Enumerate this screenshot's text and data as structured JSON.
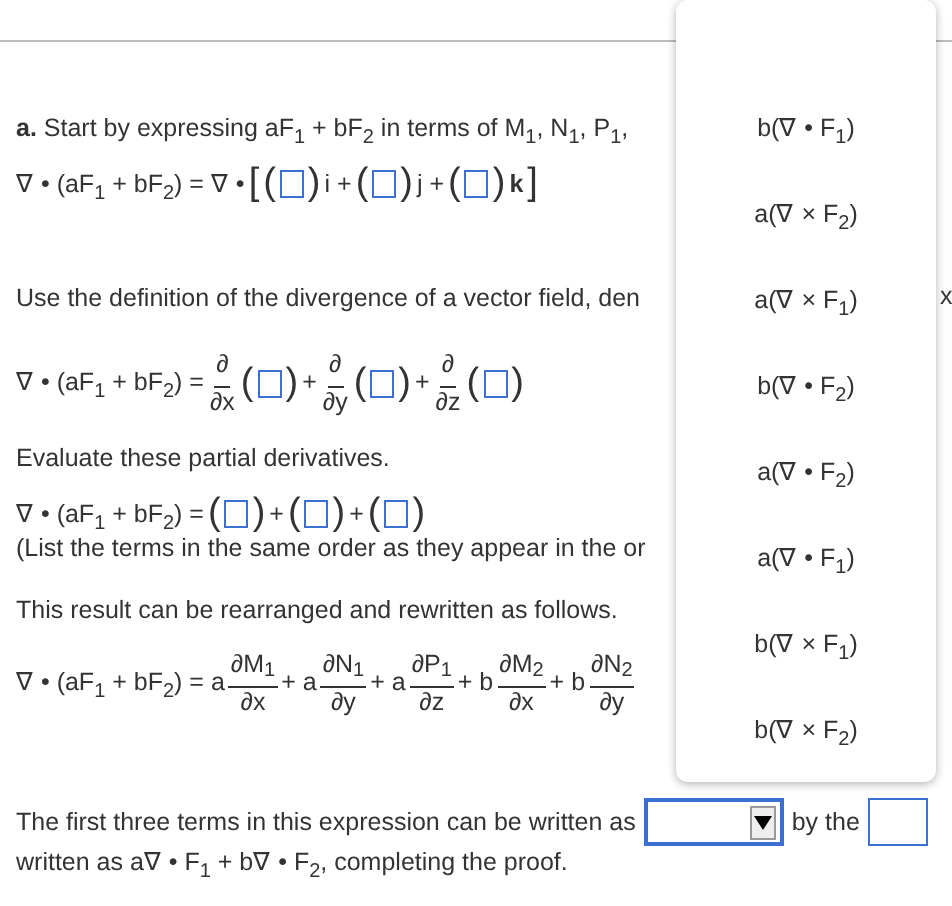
{
  "intro": "**a.** Start by expressing aF$_{1}$ + bF$_{2}$ in terms of M$_{1}$, N$_{1}$, P$_{1}$,",
  "eq1": [
    {
      "kind": "text",
      "text": "∇ • (aF$_{1}$ + bF$_{2}$) = ∇ •"
    },
    {
      "kind": "paren",
      "text": "["
    },
    {
      "kind": "paren",
      "text": "("
    },
    {
      "kind": "box"
    },
    {
      "kind": "paren",
      "text": ")"
    },
    {
      "kind": "text",
      "text": "i +"
    },
    {
      "kind": "paren",
      "text": "("
    },
    {
      "kind": "box"
    },
    {
      "kind": "paren",
      "text": ")"
    },
    {
      "kind": "text",
      "text": "j +"
    },
    {
      "kind": "paren",
      "text": "("
    },
    {
      "kind": "box"
    },
    {
      "kind": "paren",
      "text": ")"
    },
    {
      "kind": "text",
      "text": "**k**"
    },
    {
      "kind": "paren",
      "text": "]"
    }
  ],
  "p2": "Use the definition of the divergence of a vector field, den",
  "eq2": [
    {
      "kind": "text",
      "text": "∇ • (aF$_{1}$ + bF$_{2}$) ="
    },
    {
      "kind": "frac",
      "num": "∂",
      "den": "∂x"
    },
    {
      "kind": "paren",
      "text": "("
    },
    {
      "kind": "box"
    },
    {
      "kind": "paren",
      "text": ")"
    },
    {
      "kind": "text",
      "text": "+"
    },
    {
      "kind": "frac",
      "num": "∂",
      "den": "∂y"
    },
    {
      "kind": "paren",
      "text": "("
    },
    {
      "kind": "box"
    },
    {
      "kind": "paren",
      "text": ")"
    },
    {
      "kind": "text",
      "text": "+"
    },
    {
      "kind": "frac",
      "num": "∂",
      "den": "∂z"
    },
    {
      "kind": "paren",
      "text": "("
    },
    {
      "kind": "box"
    },
    {
      "kind": "paren",
      "text": ")"
    }
  ],
  "p3": "Evaluate these partial derivatives.",
  "eq3": [
    {
      "kind": "text",
      "text": "∇ • (aF$_{1}$ + bF$_{2}$) ="
    },
    {
      "kind": "paren",
      "text": "("
    },
    {
      "kind": "box"
    },
    {
      "kind": "paren",
      "text": ")"
    },
    {
      "kind": "text",
      "text": "+"
    },
    {
      "kind": "paren",
      "text": "("
    },
    {
      "kind": "box"
    },
    {
      "kind": "paren",
      "text": ")"
    },
    {
      "kind": "text",
      "text": "+"
    },
    {
      "kind": "paren",
      "text": "("
    },
    {
      "kind": "box"
    },
    {
      "kind": "paren",
      "text": ")"
    }
  ],
  "note": "(List the terms in the same order as they appear in the or",
  "p4": "This result can be rearranged and rewritten as follows.",
  "eq4": [
    {
      "kind": "text",
      "text": "∇ • (aF$_{1}$ + bF$_{2}$) = a"
    },
    {
      "kind": "frac",
      "num": "∂M$_{1}$",
      "den": "∂x"
    },
    {
      "kind": "text",
      "text": "+ a"
    },
    {
      "kind": "frac",
      "num": "∂N$_{1}$",
      "den": "∂y"
    },
    {
      "kind": "text",
      "text": "+ a"
    },
    {
      "kind": "frac",
      "num": "∂P$_{1}$",
      "den": "∂z"
    },
    {
      "kind": "text",
      "text": "+ b"
    },
    {
      "kind": "frac",
      "num": "∂M$_{2}$",
      "den": "∂x"
    },
    {
      "kind": "text",
      "text": "+ b"
    },
    {
      "kind": "frac",
      "num": "∂N$_{2}$",
      "den": "∂y"
    }
  ],
  "p5": "The first three terms in this expression can be written as",
  "p5_after": "by the",
  "p6": "written as a∇ • F$_{1}$ + b∇ • F$_{2}$, completing the proof.",
  "edge_text": "x",
  "dropdown": {
    "options": [
      "b(∇ • F$_{1}$)",
      "a(∇ × F$_{2}$)",
      "a(∇ × F$_{1}$)",
      "b(∇ • F$_{2}$)",
      "a(∇ • F$_{2}$)",
      "a(∇ • F$_{1}$)",
      "b(∇ × F$_{1}$)",
      "b(∇ × F$_{2}$)"
    ]
  }
}
